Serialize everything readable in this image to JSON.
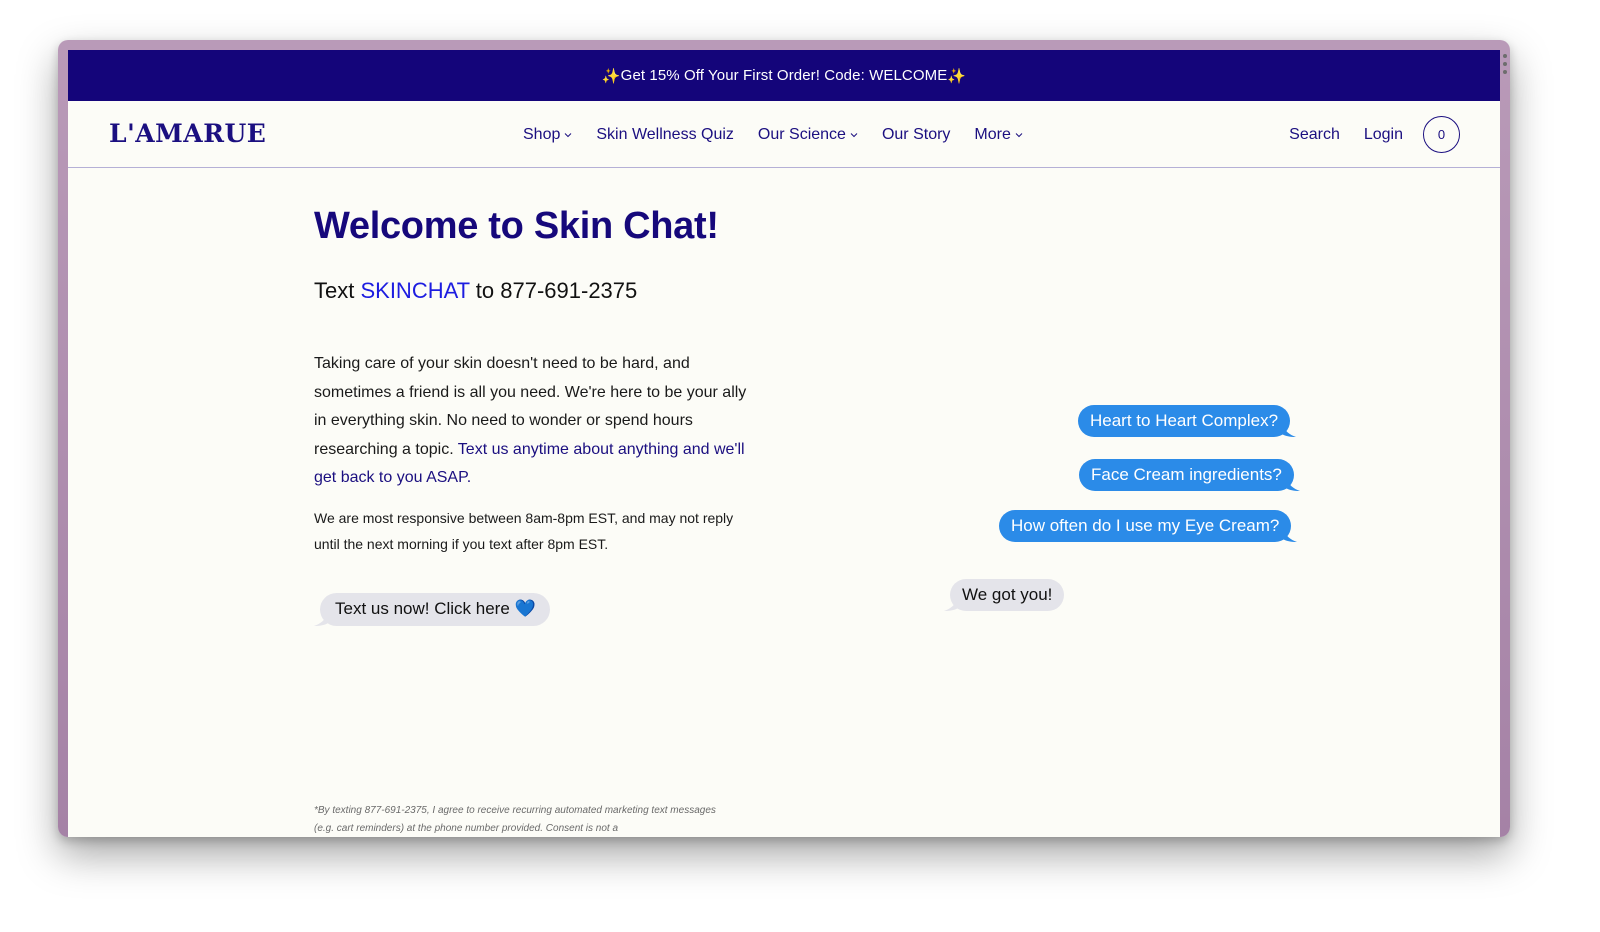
{
  "promo": {
    "spark_left": "✨",
    "text": "Get 15% Off Your First Order! Code: WELCOME",
    "spark_right": "✨"
  },
  "nav": {
    "logo": "L'AMARUE",
    "menu": [
      {
        "label": "Shop",
        "has_dropdown": true
      },
      {
        "label": "Skin Wellness Quiz",
        "has_dropdown": false
      },
      {
        "label": "Our Science",
        "has_dropdown": true
      },
      {
        "label": "Our Story",
        "has_dropdown": false
      },
      {
        "label": "More",
        "has_dropdown": true
      }
    ],
    "search": "Search",
    "login": "Login",
    "cart_count": "0"
  },
  "main": {
    "title": "Welcome to Skin Chat!",
    "subtitle": {
      "pre": "Text ",
      "keyword": "SKINCHAT",
      "post": " to 877-691-2375"
    },
    "paragraph": {
      "text": "Taking care of your skin doesn't need to be hard, and sometimes a friend is all you need. We're here to be your ally in everything skin. No need to wonder or spend hours researching a topic. ",
      "link": "Text us anytime about anything and we'll get back to you ASAP."
    },
    "note": "We are most responsive between 8am-8pm EST, and may not reply until the next morning if you text after 8pm EST.",
    "cta": {
      "label": "Text us now! Click here ",
      "icon": "💙"
    },
    "disclaimer": "*By texting 877-691-2375, I agree to receive recurring automated marketing text messages (e.g. cart reminders) at the phone number provided. Consent is not a"
  },
  "chat": {
    "outgoing": [
      "Heart to Heart Complex?",
      "Face Cream ingredients?",
      "How often do I use my Eye Cream?"
    ],
    "incoming": "We got you!"
  },
  "colors": {
    "brand": "#1b0f80",
    "promo_bg": "#14057a",
    "bubble_blue": "#2b8be8",
    "bubble_gray": "#e4e4ea",
    "keyword": "#1d1de0"
  }
}
